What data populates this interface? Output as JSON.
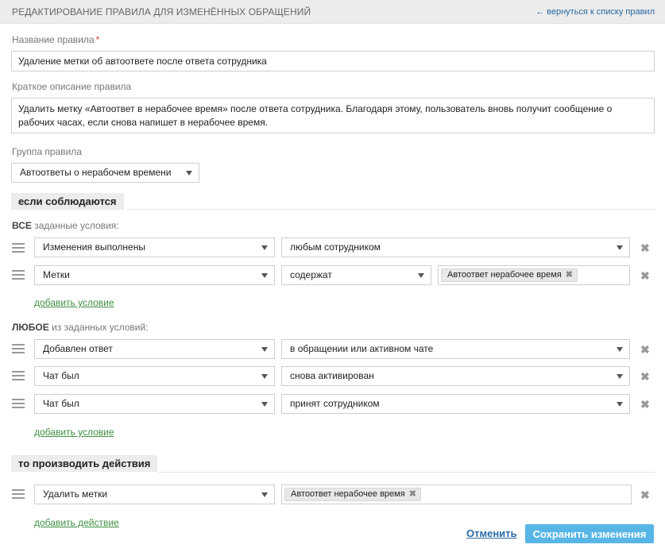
{
  "header": {
    "title": "РЕДАКТИРОВАНИЕ ПРАВИЛА ДЛЯ ИЗМЕНЁННЫХ ОБРАЩЕНИЙ",
    "back_link": "← вернуться к списку правил"
  },
  "form": {
    "name_label": "Название правила",
    "required_mark": "*",
    "name_value": "Удаление метки об автоответе после ответа сотрудника",
    "desc_label": "Краткое описание правила",
    "desc_value": "Удалить метку «Автоответ в нерабочее время» после ответа сотрудника. Благодаря этому, пользователь вновь получит сообщение о рабочих часах, если снова напишет в нерабочее время.",
    "group_label": "Группа правила",
    "group_value": "Автоответы о нерабочем времени"
  },
  "conditions": {
    "heading": "если соблюдаются",
    "all_label_strong": "ВСЕ",
    "all_label_rest": " заданные условия:",
    "all_rows": [
      {
        "field": "Изменения выполнены",
        "value": "любым сотрудником"
      },
      {
        "field": "Метки",
        "operator": "содержат",
        "tag": "Автоответ нерабочее время"
      }
    ],
    "any_label_strong": "ЛЮБОЕ",
    "any_label_rest": " из заданных условий:",
    "any_rows": [
      {
        "field": "Добавлен ответ",
        "value": "в обращении или активном чате"
      },
      {
        "field": "Чат был",
        "value": "снова активирован"
      },
      {
        "field": "Чат был",
        "value": "принят сотрудником"
      }
    ],
    "add_condition": "добавить условие"
  },
  "actions": {
    "heading": "то производить действия",
    "rows": [
      {
        "field": "Удалить метки",
        "tag": "Автоответ нерабочее время"
      }
    ],
    "add_action": "добавить действие"
  },
  "footer": {
    "cancel": "Отменить",
    "save": "Сохранить изменения"
  },
  "icons": {
    "remove": "✖",
    "tag_remove": "✖"
  },
  "colors": {
    "save_button": "#58b6e7",
    "link_blue": "#2a6aa3",
    "link_green": "#3f8f3f",
    "required": "#d23b3b"
  }
}
